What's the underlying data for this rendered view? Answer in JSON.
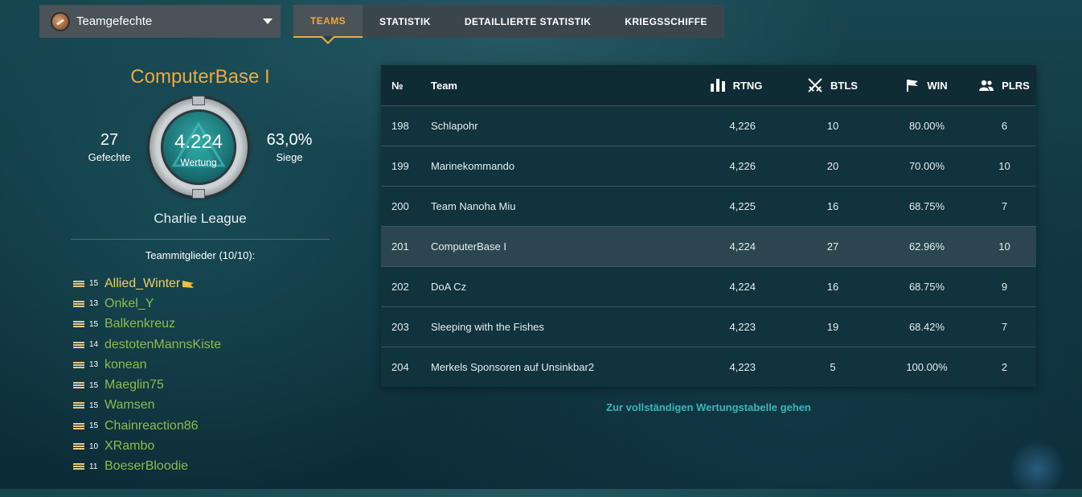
{
  "mode_select": {
    "label": "Teamgefechte",
    "icon": "mode-icon"
  },
  "tabs": [
    "TEAMS",
    "STATISTIK",
    "DETAILLIERTE STATISTIK",
    "KRIEGSSCHIFFE"
  ],
  "active_tab": "TEAMS",
  "team": {
    "name": "ComputerBase I",
    "battles": {
      "value": "27",
      "label": "Gefechte"
    },
    "wins": {
      "value": "63,0%",
      "label": "Siege"
    },
    "rating": {
      "value": "4.224",
      "label": "Wertung"
    },
    "league": "Charlie League"
  },
  "members_title": "Teammitglieder (10/10):",
  "members": [
    {
      "level": "15",
      "name": "Allied_Winter",
      "leader": true
    },
    {
      "level": "13",
      "name": "Onkel_Y"
    },
    {
      "level": "15",
      "name": "Balkenkreuz"
    },
    {
      "level": "14",
      "name": "destotenMannsKiste"
    },
    {
      "level": "13",
      "name": "konean"
    },
    {
      "level": "15",
      "name": "Maeglin75"
    },
    {
      "level": "15",
      "name": "Wamsen"
    },
    {
      "level": "15",
      "name": "Chainreaction86"
    },
    {
      "level": "10",
      "name": "XRambo"
    },
    {
      "level": "11",
      "name": "BoeserBloodie"
    }
  ],
  "table": {
    "headers": {
      "no": "№",
      "team": "Team",
      "rtng": "RTNG",
      "btls": "BTLS",
      "win": "WIN",
      "plrs": "PLRS"
    },
    "rows": [
      {
        "no": "198",
        "team": "Schlapohr",
        "rtng": "4,226",
        "btls": "10",
        "win": "80.00%",
        "plrs": "6"
      },
      {
        "no": "199",
        "team": "Marinekommando",
        "rtng": "4,226",
        "btls": "20",
        "win": "70.00%",
        "plrs": "10"
      },
      {
        "no": "200",
        "team": "Team Nanoha Miu",
        "rtng": "4,225",
        "btls": "16",
        "win": "68.75%",
        "plrs": "7"
      },
      {
        "no": "201",
        "team": "ComputerBase I",
        "rtng": "4,224",
        "btls": "27",
        "win": "62.96%",
        "plrs": "10",
        "highlight": true
      },
      {
        "no": "202",
        "team": "DoA Cz",
        "rtng": "4,224",
        "btls": "16",
        "win": "68.75%",
        "plrs": "9"
      },
      {
        "no": "203",
        "team": "Sleeping with the Fishes",
        "rtng": "4,223",
        "btls": "19",
        "win": "68.42%",
        "plrs": "7"
      },
      {
        "no": "204",
        "team": "Merkels Sponsoren auf Unsinkbar2",
        "rtng": "4,223",
        "btls": "5",
        "win": "100.00%",
        "plrs": "2"
      }
    ]
  },
  "full_table_link": "Zur vollständigen Wertungstabelle gehen",
  "colors": {
    "accent": "#f0a83c",
    "member": "#8fbc4a",
    "leader": "#f0d060",
    "link": "#3bb7ba"
  }
}
